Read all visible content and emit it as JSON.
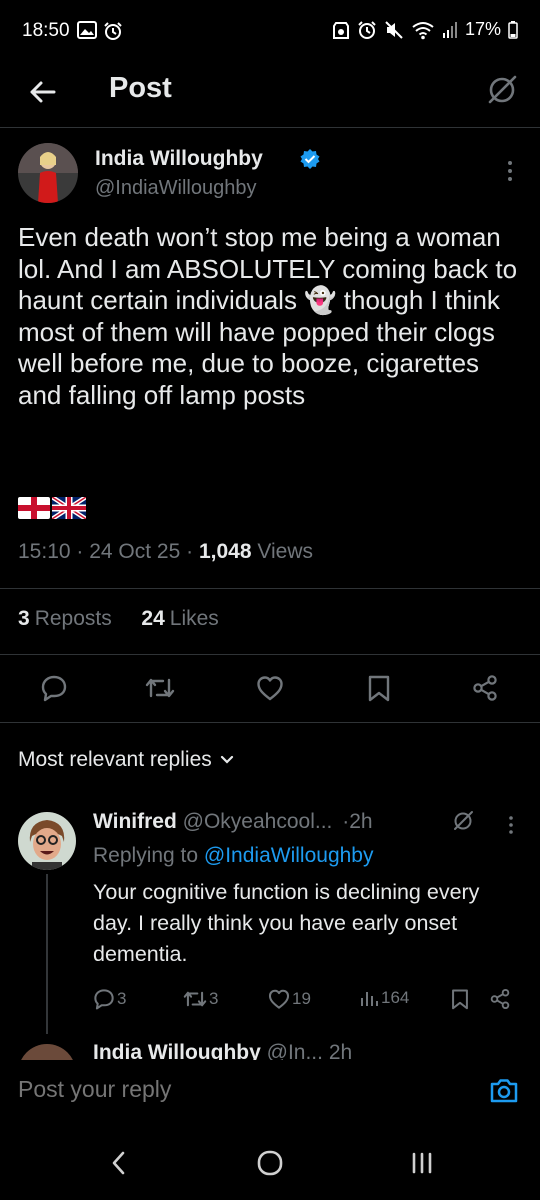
{
  "status_bar": {
    "time": "18:50",
    "battery": "17%"
  },
  "header": {
    "title": "Post",
    "back_icon": "arrow-left-icon",
    "grok_icon": "grok-icon"
  },
  "post": {
    "author_name": "India Willoughby",
    "author_handle": "@IndiaWilloughby",
    "verified": true,
    "text_before_emoji": "Even death won’t stop me being a woman lol. And I am ABSOLUTELY coming back to haunt certain individuals ",
    "inline_emoji": "👻",
    "text_after_emoji": " though I think most of them will have popped their clogs well before me, due to booze, cigarettes and falling off lamp posts",
    "flags": [
      "england-flag",
      "uk-flag"
    ],
    "time": "15:10",
    "date": "24 Oct 25",
    "views_count": "1,048",
    "views_label": "Views",
    "reposts_count": "3",
    "reposts_label": "Reposts",
    "likes_count": "24",
    "likes_label": "Likes"
  },
  "replies_section": {
    "label": "Most relevant replies"
  },
  "reply": {
    "author_name": "Winifred",
    "author_handle": "@Okyeahcool...",
    "separator": "·",
    "time_ago": "2h",
    "replying_to_label": "Replying to",
    "replying_to_handle": "@IndiaWilloughby",
    "text": "Your cognitive function is declining every day. I really think you have early onset dementia.",
    "reply_count": "3",
    "repost_count": "3",
    "like_count": "19",
    "view_count": "164"
  },
  "next_reply_peek": {
    "author_name": "India Willoughby",
    "handle_partial": "@In...",
    "time_ago": "2h"
  },
  "compose": {
    "placeholder": "Post your reply"
  },
  "colors": {
    "background": "#000000",
    "text_primary": "#e7e9ea",
    "text_secondary": "#71767b",
    "accent": "#1d9bf0",
    "divider": "#2f3336"
  }
}
